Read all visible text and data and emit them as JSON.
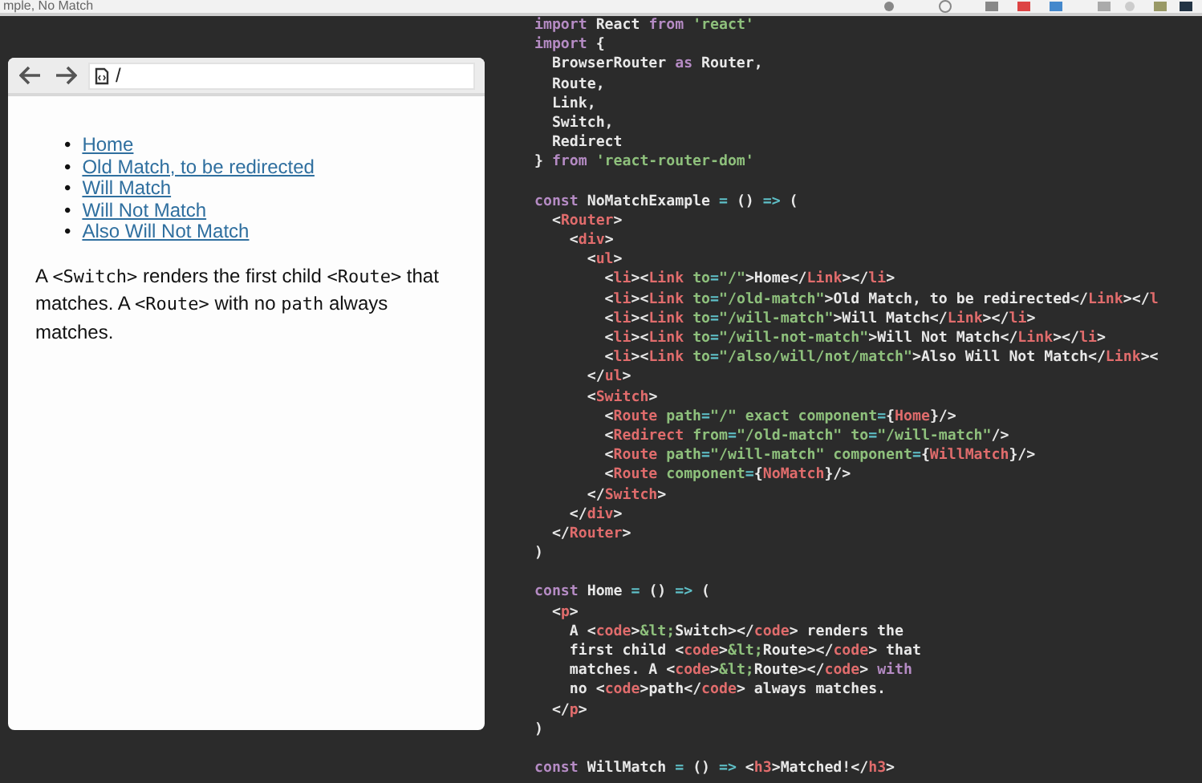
{
  "top_bar": {
    "tab_title": "mple, No Match"
  },
  "browser": {
    "address": "/",
    "links": [
      {
        "marker": "•",
        "text": "Home"
      },
      {
        "marker": "•",
        "text": "Old Match, to be redirected"
      },
      {
        "marker": "•",
        "text": "Will Match"
      },
      {
        "marker": "•",
        "text": "Will Not Match"
      },
      {
        "marker": "•",
        "text": "Also Will Not Match"
      }
    ],
    "paragraph": [
      {
        "text": "A ",
        "code": false
      },
      {
        "text": "<Switch>",
        "code": true
      },
      {
        "text": " renders the first child ",
        "code": false
      },
      {
        "text": "<Route>",
        "code": true
      },
      {
        "text": " that matches. A ",
        "code": false
      },
      {
        "text": "<Route>",
        "code": true
      },
      {
        "text": " with no ",
        "code": false
      },
      {
        "text": "path",
        "code": true
      },
      {
        "text": " always matches.",
        "code": false
      }
    ]
  },
  "code_blocks": [
    [
      [
        {
          "kind": "kw",
          "text": "import"
        },
        {
          "kind": "txt",
          "text": " React "
        },
        {
          "kind": "kw",
          "text": "from"
        },
        {
          "kind": "str",
          "text": " 'react'"
        }
      ],
      [
        {
          "kind": "kw",
          "text": "import"
        },
        {
          "kind": "txt",
          "text": " {"
        }
      ],
      [
        {
          "kind": "txt",
          "text": "  BrowserRouter "
        },
        {
          "kind": "kw",
          "text": "as"
        },
        {
          "kind": "txt",
          "text": " Router,"
        }
      ],
      [
        {
          "kind": "txt",
          "text": "  Route,"
        }
      ],
      [
        {
          "kind": "txt",
          "text": "  Link,"
        }
      ],
      [
        {
          "kind": "txt",
          "text": "  Switch,"
        }
      ],
      [
        {
          "kind": "txt",
          "text": "  Redirect"
        }
      ],
      [
        {
          "kind": "txt",
          "text": "} "
        },
        {
          "kind": "kw",
          "text": "from"
        },
        {
          "kind": "str",
          "text": " 'react-router-dom'"
        }
      ]
    ],
    [
      [
        {
          "kind": "kw",
          "text": "const"
        },
        {
          "kind": "txt",
          "text": " NoMatchExample "
        },
        {
          "kind": "op",
          "text": "="
        },
        {
          "kind": "txt",
          "text": " () "
        },
        {
          "kind": "op",
          "text": "=>"
        },
        {
          "kind": "txt",
          "text": " ("
        }
      ],
      [
        {
          "kind": "txt",
          "text": "  <"
        },
        {
          "kind": "tag",
          "text": "Router"
        },
        {
          "kind": "txt",
          "text": ">"
        }
      ],
      [
        {
          "kind": "txt",
          "text": "    <"
        },
        {
          "kind": "tag",
          "text": "div"
        },
        {
          "kind": "txt",
          "text": ">"
        }
      ],
      [
        {
          "kind": "txt",
          "text": "      <"
        },
        {
          "kind": "tag",
          "text": "ul"
        },
        {
          "kind": "txt",
          "text": ">"
        }
      ],
      [
        {
          "kind": "txt",
          "text": "        <"
        },
        {
          "kind": "tag",
          "text": "li"
        },
        {
          "kind": "txt",
          "text": "><"
        },
        {
          "kind": "tag",
          "text": "Link"
        },
        {
          "kind": "attr",
          "text": " to"
        },
        {
          "kind": "op",
          "text": "="
        },
        {
          "kind": "str",
          "text": "\"/\""
        },
        {
          "kind": "txt",
          "text": ">Home</"
        },
        {
          "kind": "tag",
          "text": "Link"
        },
        {
          "kind": "txt",
          "text": "></"
        },
        {
          "kind": "tag",
          "text": "li"
        },
        {
          "kind": "txt",
          "text": ">"
        }
      ],
      [
        {
          "kind": "txt",
          "text": "        <"
        },
        {
          "kind": "tag",
          "text": "li"
        },
        {
          "kind": "txt",
          "text": "><"
        },
        {
          "kind": "tag",
          "text": "Link"
        },
        {
          "kind": "attr",
          "text": " to"
        },
        {
          "kind": "op",
          "text": "="
        },
        {
          "kind": "str",
          "text": "\"/old-match\""
        },
        {
          "kind": "txt",
          "text": ">Old Match, to be redirected</"
        },
        {
          "kind": "tag",
          "text": "Link"
        },
        {
          "kind": "txt",
          "text": "></"
        },
        {
          "kind": "tag",
          "text": "l"
        }
      ],
      [
        {
          "kind": "txt",
          "text": "        <"
        },
        {
          "kind": "tag",
          "text": "li"
        },
        {
          "kind": "txt",
          "text": "><"
        },
        {
          "kind": "tag",
          "text": "Link"
        },
        {
          "kind": "attr",
          "text": " to"
        },
        {
          "kind": "op",
          "text": "="
        },
        {
          "kind": "str",
          "text": "\"/will-match\""
        },
        {
          "kind": "txt",
          "text": ">Will Match</"
        },
        {
          "kind": "tag",
          "text": "Link"
        },
        {
          "kind": "txt",
          "text": "></"
        },
        {
          "kind": "tag",
          "text": "li"
        },
        {
          "kind": "txt",
          "text": ">"
        }
      ],
      [
        {
          "kind": "txt",
          "text": "        <"
        },
        {
          "kind": "tag",
          "text": "li"
        },
        {
          "kind": "txt",
          "text": "><"
        },
        {
          "kind": "tag",
          "text": "Link"
        },
        {
          "kind": "attr",
          "text": " to"
        },
        {
          "kind": "op",
          "text": "="
        },
        {
          "kind": "str",
          "text": "\"/will-not-match\""
        },
        {
          "kind": "txt",
          "text": ">Will Not Match</"
        },
        {
          "kind": "tag",
          "text": "Link"
        },
        {
          "kind": "txt",
          "text": "></"
        },
        {
          "kind": "tag",
          "text": "li"
        },
        {
          "kind": "txt",
          "text": ">"
        }
      ],
      [
        {
          "kind": "txt",
          "text": "        <"
        },
        {
          "kind": "tag",
          "text": "li"
        },
        {
          "kind": "txt",
          "text": "><"
        },
        {
          "kind": "tag",
          "text": "Link"
        },
        {
          "kind": "attr",
          "text": " to"
        },
        {
          "kind": "op",
          "text": "="
        },
        {
          "kind": "str",
          "text": "\"/also/will/not/match\""
        },
        {
          "kind": "txt",
          "text": ">Also Will Not Match</"
        },
        {
          "kind": "tag",
          "text": "Link"
        },
        {
          "kind": "txt",
          "text": "><"
        }
      ],
      [
        {
          "kind": "txt",
          "text": "      </"
        },
        {
          "kind": "tag",
          "text": "ul"
        },
        {
          "kind": "txt",
          "text": ">"
        }
      ],
      [
        {
          "kind": "txt",
          "text": "      <"
        },
        {
          "kind": "tag",
          "text": "Switch"
        },
        {
          "kind": "txt",
          "text": ">"
        }
      ],
      [
        {
          "kind": "txt",
          "text": "        <"
        },
        {
          "kind": "tag",
          "text": "Route"
        },
        {
          "kind": "attr",
          "text": " path"
        },
        {
          "kind": "op",
          "text": "="
        },
        {
          "kind": "str",
          "text": "\"/\""
        },
        {
          "kind": "attr",
          "text": " exact"
        },
        {
          "kind": "attr",
          "text": " component"
        },
        {
          "kind": "op",
          "text": "="
        },
        {
          "kind": "txt",
          "text": "{"
        },
        {
          "kind": "tag",
          "text": "Home"
        },
        {
          "kind": "txt",
          "text": "}/>"
        }
      ],
      [
        {
          "kind": "txt",
          "text": "        <"
        },
        {
          "kind": "tag",
          "text": "Redirect"
        },
        {
          "kind": "attr",
          "text": " from"
        },
        {
          "kind": "op",
          "text": "="
        },
        {
          "kind": "str",
          "text": "\"/old-match\""
        },
        {
          "kind": "attr",
          "text": " to"
        },
        {
          "kind": "op",
          "text": "="
        },
        {
          "kind": "str",
          "text": "\"/will-match\""
        },
        {
          "kind": "txt",
          "text": "/>"
        }
      ],
      [
        {
          "kind": "txt",
          "text": "        <"
        },
        {
          "kind": "tag",
          "text": "Route"
        },
        {
          "kind": "attr",
          "text": " path"
        },
        {
          "kind": "op",
          "text": "="
        },
        {
          "kind": "str",
          "text": "\"/will-match\""
        },
        {
          "kind": "attr",
          "text": " component"
        },
        {
          "kind": "op",
          "text": "="
        },
        {
          "kind": "txt",
          "text": "{"
        },
        {
          "kind": "tag",
          "text": "WillMatch"
        },
        {
          "kind": "txt",
          "text": "}/>"
        }
      ],
      [
        {
          "kind": "txt",
          "text": "        <"
        },
        {
          "kind": "tag",
          "text": "Route"
        },
        {
          "kind": "attr",
          "text": " component"
        },
        {
          "kind": "op",
          "text": "="
        },
        {
          "kind": "txt",
          "text": "{"
        },
        {
          "kind": "tag",
          "text": "NoMatch"
        },
        {
          "kind": "txt",
          "text": "}/>"
        }
      ],
      [
        {
          "kind": "txt",
          "text": "      </"
        },
        {
          "kind": "tag",
          "text": "Switch"
        },
        {
          "kind": "txt",
          "text": ">"
        }
      ],
      [
        {
          "kind": "txt",
          "text": "    </"
        },
        {
          "kind": "tag",
          "text": "div"
        },
        {
          "kind": "txt",
          "text": ">"
        }
      ],
      [
        {
          "kind": "txt",
          "text": "  </"
        },
        {
          "kind": "tag",
          "text": "Router"
        },
        {
          "kind": "txt",
          "text": ">"
        }
      ],
      [
        {
          "kind": "txt",
          "text": ")"
        }
      ]
    ],
    [
      [
        {
          "kind": "kw",
          "text": "const"
        },
        {
          "kind": "txt",
          "text": " Home "
        },
        {
          "kind": "op",
          "text": "="
        },
        {
          "kind": "txt",
          "text": " () "
        },
        {
          "kind": "op",
          "text": "=>"
        },
        {
          "kind": "txt",
          "text": " ("
        }
      ],
      [
        {
          "kind": "txt",
          "text": "  <"
        },
        {
          "kind": "tag",
          "text": "p"
        },
        {
          "kind": "txt",
          "text": ">"
        }
      ],
      [
        {
          "kind": "txt",
          "text": "    A <"
        },
        {
          "kind": "tag",
          "text": "code"
        },
        {
          "kind": "txt",
          "text": ">"
        },
        {
          "kind": "str",
          "text": "&lt;"
        },
        {
          "kind": "txt",
          "text": "Switch></"
        },
        {
          "kind": "tag",
          "text": "code"
        },
        {
          "kind": "txt",
          "text": "> renders the"
        }
      ],
      [
        {
          "kind": "txt",
          "text": "    first child <"
        },
        {
          "kind": "tag",
          "text": "code"
        },
        {
          "kind": "txt",
          "text": ">"
        },
        {
          "kind": "str",
          "text": "&lt;"
        },
        {
          "kind": "txt",
          "text": "Route></"
        },
        {
          "kind": "tag",
          "text": "code"
        },
        {
          "kind": "txt",
          "text": "> that"
        }
      ],
      [
        {
          "kind": "txt",
          "text": "    matches. A <"
        },
        {
          "kind": "tag",
          "text": "code"
        },
        {
          "kind": "txt",
          "text": ">"
        },
        {
          "kind": "str",
          "text": "&lt;"
        },
        {
          "kind": "txt",
          "text": "Route></"
        },
        {
          "kind": "tag",
          "text": "code"
        },
        {
          "kind": "txt",
          "text": ">"
        },
        {
          "kind": "kw",
          "text": " with"
        }
      ],
      [
        {
          "kind": "txt",
          "text": "    no <"
        },
        {
          "kind": "tag",
          "text": "code"
        },
        {
          "kind": "txt",
          "text": ">path</"
        },
        {
          "kind": "tag",
          "text": "code"
        },
        {
          "kind": "txt",
          "text": "> always matches."
        }
      ],
      [
        {
          "kind": "txt",
          "text": "  </"
        },
        {
          "kind": "tag",
          "text": "p"
        },
        {
          "kind": "txt",
          "text": ">"
        }
      ],
      [
        {
          "kind": "txt",
          "text": ")"
        }
      ]
    ],
    [
      [
        {
          "kind": "kw",
          "text": "const"
        },
        {
          "kind": "txt",
          "text": " WillMatch "
        },
        {
          "kind": "op",
          "text": "="
        },
        {
          "kind": "txt",
          "text": " () "
        },
        {
          "kind": "op",
          "text": "=>"
        },
        {
          "kind": "txt",
          "text": " <"
        },
        {
          "kind": "tag",
          "text": "h3"
        },
        {
          "kind": "txt",
          "text": ">Matched!</"
        },
        {
          "kind": "tag",
          "text": "h3"
        },
        {
          "kind": "txt",
          "text": ">"
        }
      ]
    ]
  ]
}
